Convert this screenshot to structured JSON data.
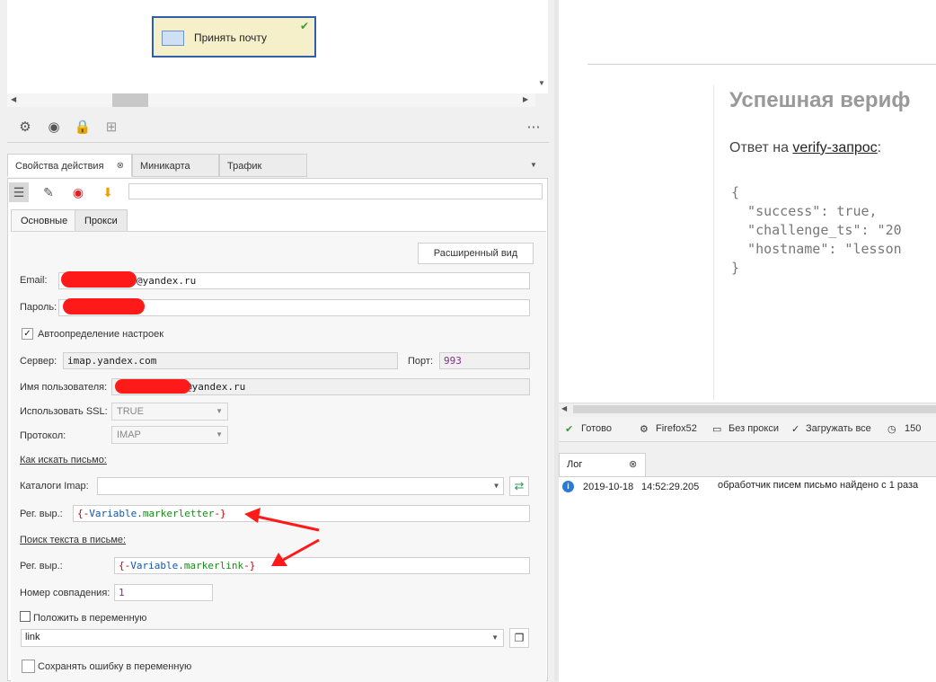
{
  "canvas": {
    "node_label": "Принять почту"
  },
  "tabs": {
    "items": [
      "Свойства действия",
      "Миникарта",
      "Трафик"
    ]
  },
  "subtabs": {
    "items": [
      "Основные",
      "Прокси"
    ]
  },
  "form": {
    "extended_view_button": "Расширенный вид",
    "email_label": "Email:",
    "email_value": "@yandex.ru",
    "password_label": "Пароль:",
    "auto_settings_label": "Автоопределение настроек",
    "server_label": "Сервер:",
    "server_value": "imap.yandex.com",
    "port_label": "Порт:",
    "port_value": "993",
    "username_label": "Имя пользователя:",
    "username_value": "@yandex.ru",
    "ssl_label": "Использовать SSL:",
    "ssl_value": "TRUE",
    "protocol_label": "Протокол:",
    "protocol_value": "IMAP",
    "how_to_find_link": "Как искать письмо:",
    "imap_folders_label": "Каталоги Imap:",
    "regex1_label": "Рег. выр.:",
    "regex1_value": {
      "open": "{-",
      "name": "Variable",
      "dot": ".",
      "key": "markerletter",
      "close": "-}"
    },
    "search_text_link": "Поиск текста в письме:",
    "regex2_label": "Рег. выр.:",
    "regex2_value": {
      "open": "{-",
      "name": "Variable",
      "dot": ".",
      "key": "markerlink",
      "close": "-}"
    },
    "match_number_label": "Номер совпадения:",
    "match_number_value": "1",
    "put_into_variable_label": "Положить в переменную",
    "variable_value": "link",
    "save_error_label": "Сохранять ошибку в переменную"
  },
  "web": {
    "heading": "Успешная вериф",
    "paragraph_prefix": "Ответ на ",
    "paragraph_link": "verify-запрос",
    "paragraph_suffix": ":",
    "code": "{\n  \"success\": true,\n  \"challenge_ts\": \"20\n  \"hostname\": \"lesson\n}"
  },
  "status": {
    "ready": "Готово",
    "browser": "Firefox52",
    "proxy": "Без прокси",
    "load": "Загружать все",
    "timeout": "150"
  },
  "log": {
    "tab_label": "Лог",
    "entries": [
      {
        "date": "2019-10-18",
        "time": "14:52:29.205",
        "message": "обработчик писем письмо найдено с 1 раза"
      }
    ]
  },
  "colors": {
    "accent_blue": "#2f5fa8",
    "annotation_red": "#ff1a1a",
    "node_bg": "#f5f0c9"
  }
}
